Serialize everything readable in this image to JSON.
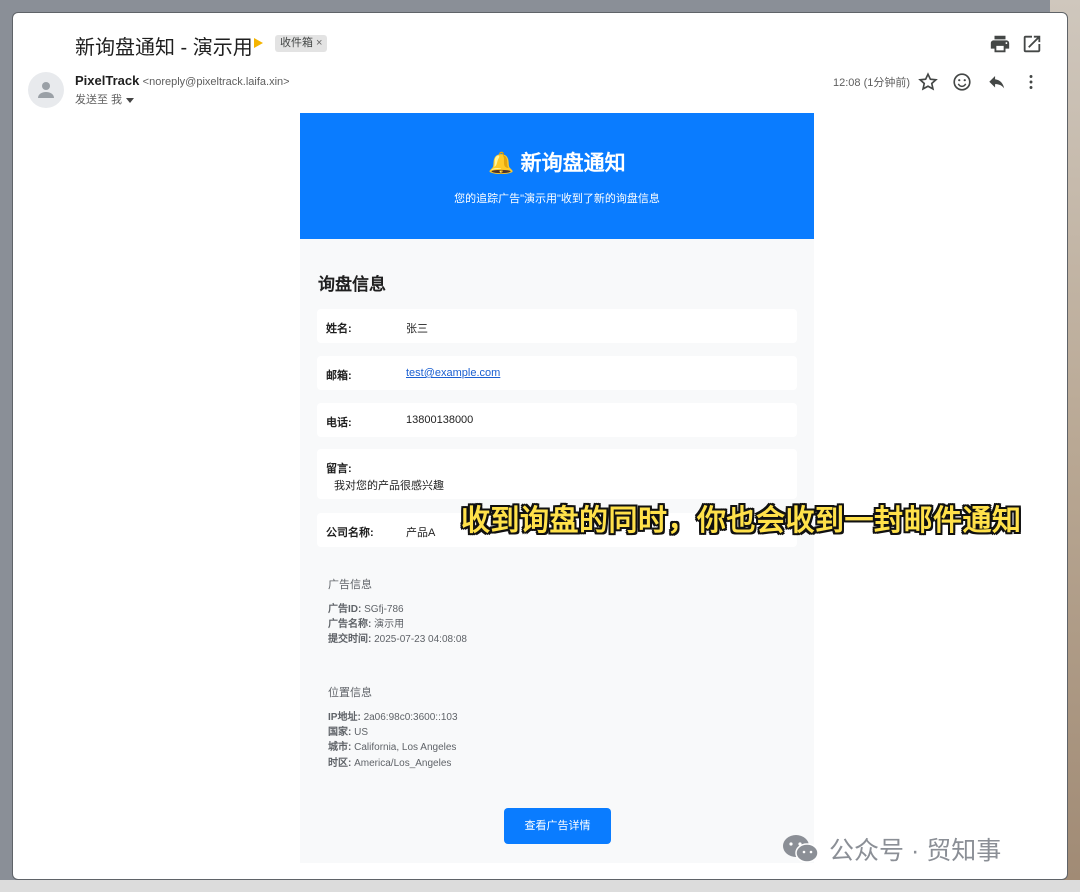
{
  "header": {
    "subject": "新询盘通知 - 演示用",
    "label_chip": "收件箱",
    "label_close": "×"
  },
  "sender": {
    "name": "PixelTrack",
    "email": "<noreply@pixeltrack.laifa.xin>",
    "to": "发送至 我",
    "time": "12:08 (1分钟前)"
  },
  "email": {
    "title": "新询盘通知",
    "bell": "🔔",
    "subtitle": "您的追踪广告\"演示用\"收到了新的询盘信息",
    "section_title": "询盘信息",
    "fields": [
      {
        "label": "姓名:",
        "value": "张三"
      },
      {
        "label": "邮箱:",
        "value": "test@example.com"
      },
      {
        "label": "电话:",
        "value": "13800138000"
      },
      {
        "label": "留言:",
        "value": "我对您的产品很感兴趣"
      },
      {
        "label": "公司名称:",
        "value": "产品A"
      }
    ],
    "ad_info": {
      "title": "广告信息",
      "rows": [
        {
          "label": "广告ID:",
          "value": "SGfj-786"
        },
        {
          "label": "广告名称:",
          "value": "演示用"
        },
        {
          "label": "提交时间:",
          "value": "2025-07-23 04:08:08"
        }
      ]
    },
    "location_info": {
      "title": "位置信息",
      "rows": [
        {
          "label": "IP地址:",
          "value": "2a06:98c0:3600::103"
        },
        {
          "label": "国家:",
          "value": "US"
        },
        {
          "label": "城市:",
          "value": "California, Los Angeles"
        },
        {
          "label": "时区:",
          "value": "America/Los_Angeles"
        }
      ]
    },
    "button_label": "查看广告详情"
  },
  "overlay_caption": "收到询盘的同时，你也会收到一封邮件通知",
  "watermark": "公众号 · 贸知事",
  "colors": {
    "header_blue": "#0a7cff",
    "label_arrow": "#f5b400",
    "caption_yellow": "#ffe14a",
    "link_blue": "#1a5fd1"
  }
}
